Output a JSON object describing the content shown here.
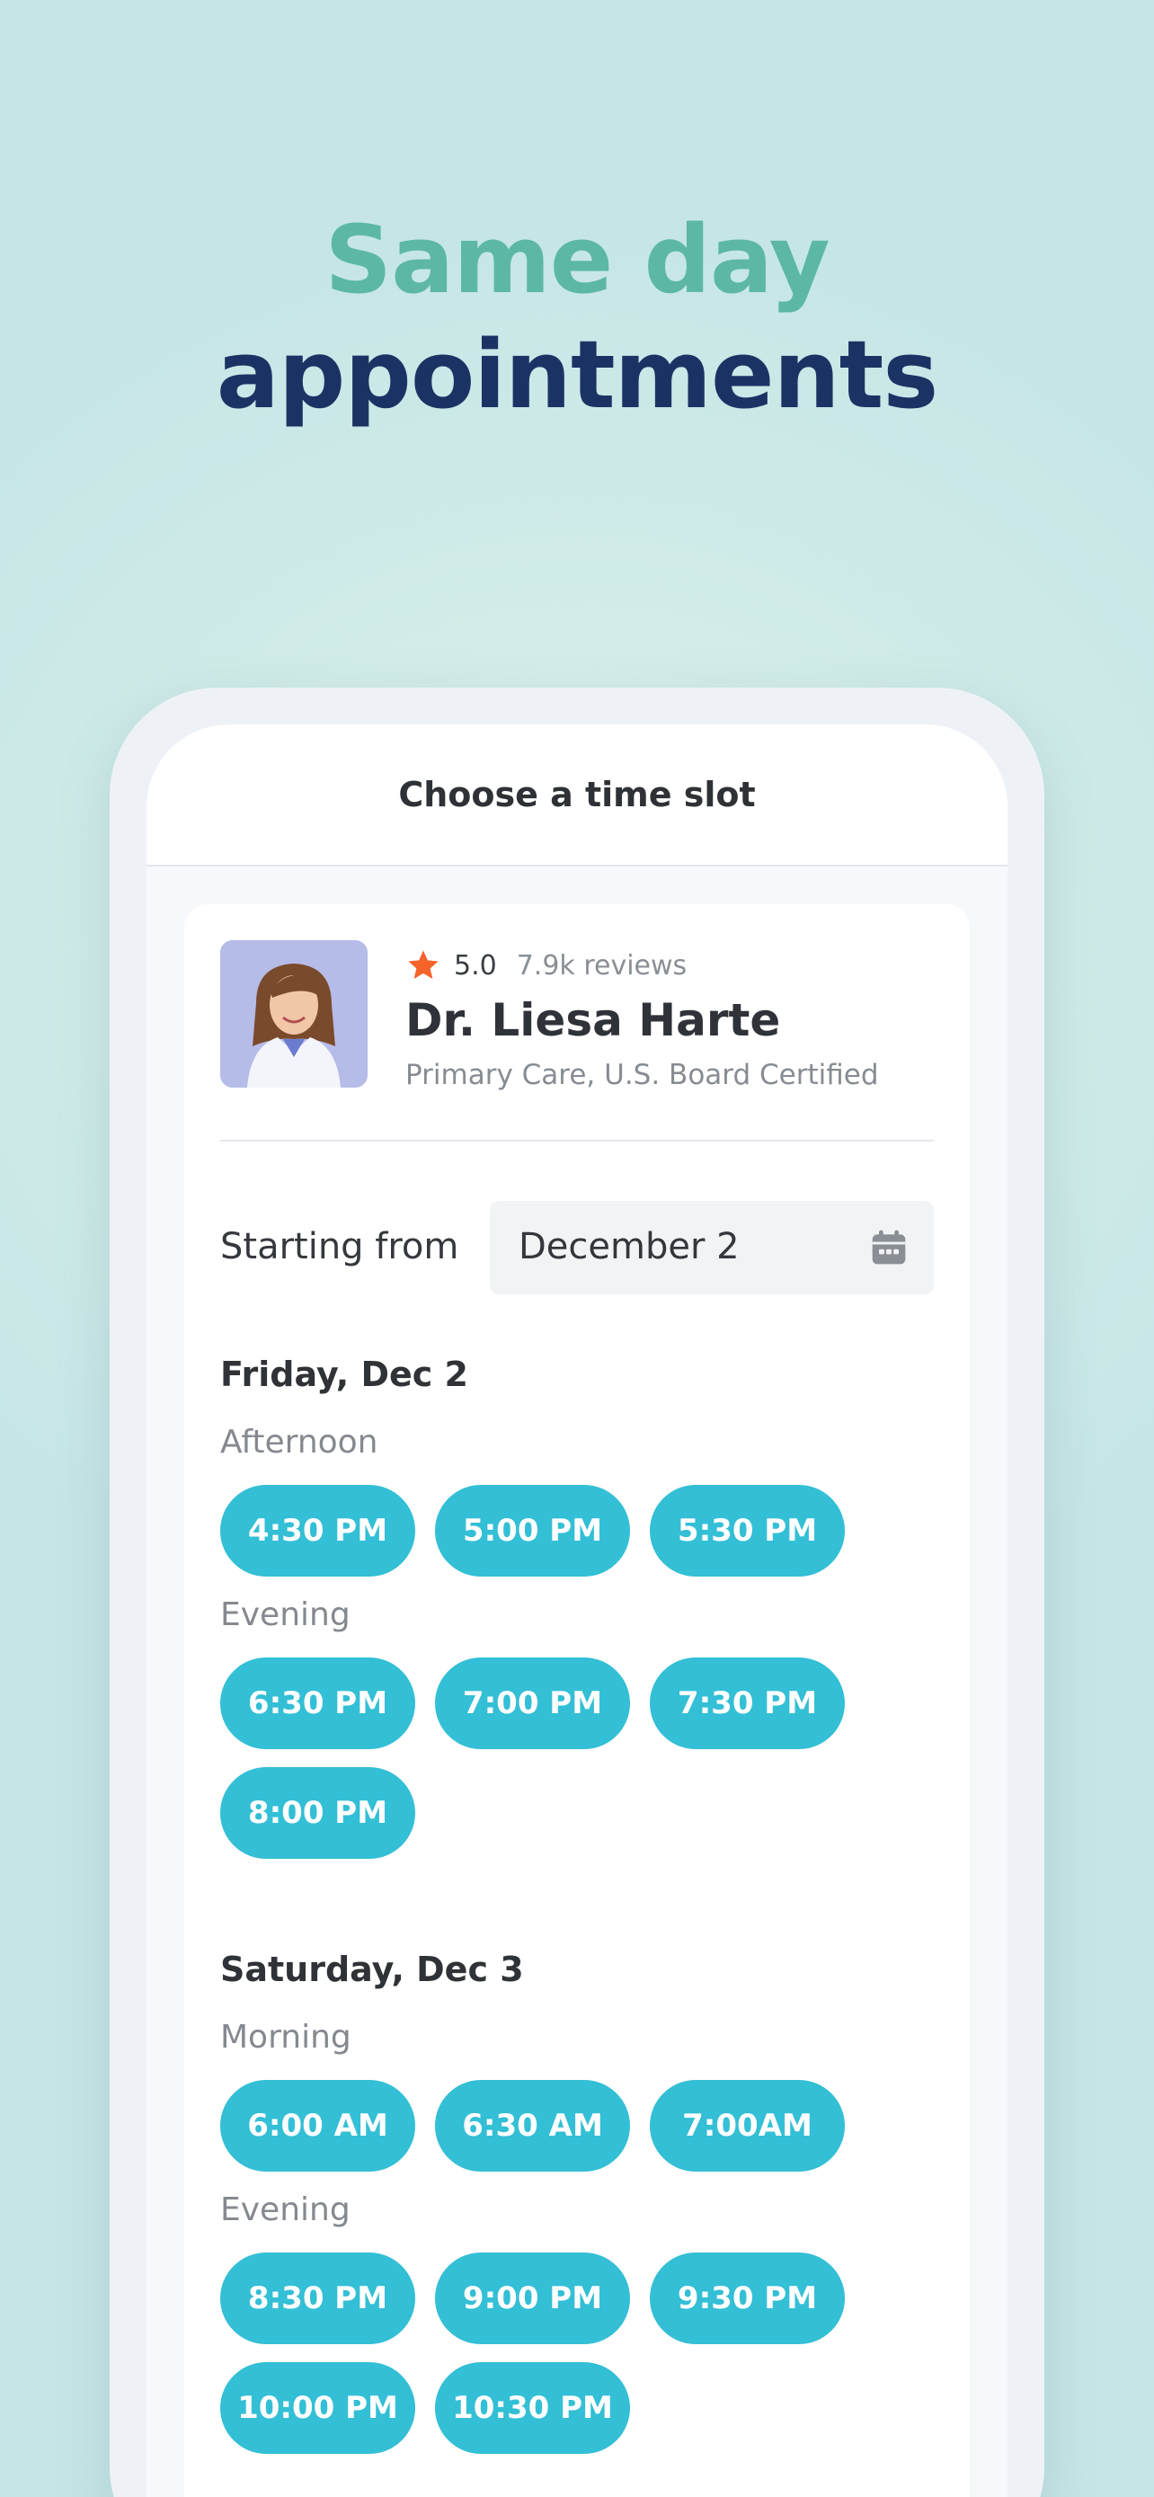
{
  "headline": {
    "line1": "Same day",
    "line2": "appointments"
  },
  "screen": {
    "title": "Choose a time slot"
  },
  "doctor": {
    "rating": "5.0",
    "reviews": "7.9k reviews",
    "name": "Dr. Liesa Harte",
    "specialty": "Primary Care, U.S. Board Certified"
  },
  "date_picker": {
    "label": "Starting from",
    "value": "December 2",
    "icon": "calendar-icon"
  },
  "days": [
    {
      "title": "Friday, Dec 2",
      "periods": [
        {
          "name": "Afternoon",
          "slots": [
            "4:30 PM",
            "5:00 PM",
            "5:30 PM"
          ]
        },
        {
          "name": "Evening",
          "slots": [
            "6:30 PM",
            "7:00 PM",
            "7:30 PM",
            "8:00 PM"
          ]
        }
      ]
    },
    {
      "title": "Saturday, Dec 3",
      "periods": [
        {
          "name": "Morning",
          "slots": [
            "6:00 AM",
            "6:30 AM",
            "7:00AM"
          ]
        },
        {
          "name": "Evening",
          "slots": [
            "8:30 PM",
            "9:00 PM",
            "9:30 PM",
            "10:00 PM",
            "10:30 PM"
          ]
        }
      ]
    }
  ],
  "colors": {
    "accent_teal": "#5cb8a4",
    "navy": "#1b3364",
    "slot_blue": "#33bfd5",
    "star_orange": "#f5622a"
  }
}
